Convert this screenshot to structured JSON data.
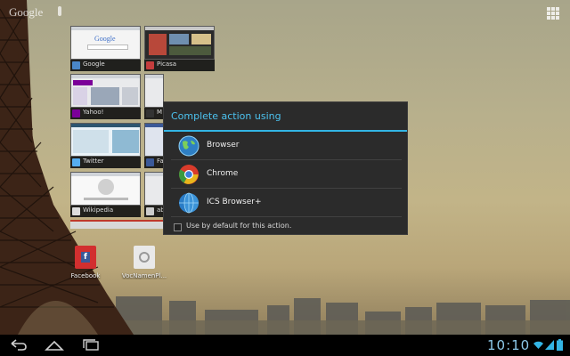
{
  "top_bar": {
    "search_label": "Google"
  },
  "recent_apps": [
    {
      "label": "Google",
      "icon_color": "#4a87c7"
    },
    {
      "label": "Picasa",
      "icon_color": "#c43d3d"
    },
    {
      "label": "Yahoo!",
      "icon_color": "#7b0099"
    },
    {
      "label": "M",
      "icon_color": "#333333"
    },
    {
      "label": "Twitter",
      "icon_color": "#55acee"
    },
    {
      "label": "Fa",
      "icon_color": "#3b5998"
    },
    {
      "label": "Wikipedia",
      "icon_color": "#dddddd"
    },
    {
      "label": "ab",
      "icon_color": "#cccccc"
    }
  ],
  "home_icons": [
    {
      "label": "Facebook"
    },
    {
      "label": "VocNamenPl..."
    }
  ],
  "dialog": {
    "title": "Complete action using",
    "options": [
      {
        "label": "Browser",
        "icon": "globe-icon"
      },
      {
        "label": "Chrome",
        "icon": "chrome-icon"
      },
      {
        "label": "ICS Browser+",
        "icon": "globe-icon"
      }
    ],
    "default_checkbox_label": "Use by default for this action.",
    "default_checked": false
  },
  "status": {
    "time": "10:10"
  },
  "colors": {
    "accent": "#33b5e5",
    "dialog_bg": "#2b2b2b"
  }
}
